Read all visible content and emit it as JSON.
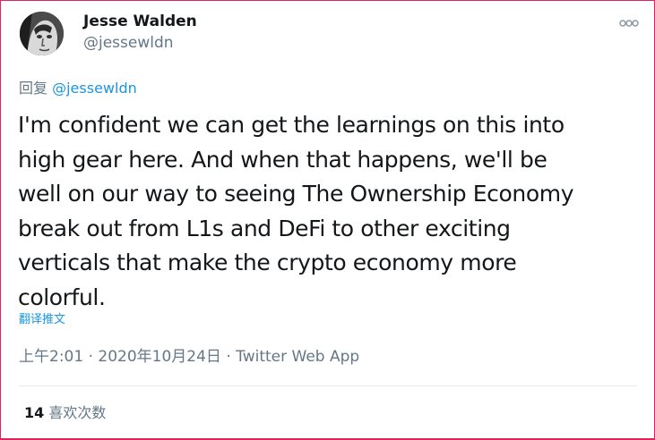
{
  "author": {
    "name": "Jesse Walden",
    "handle": "@jessewldn"
  },
  "reply": {
    "prefix": "回复",
    "mention": "@jessewldn"
  },
  "tweet": {
    "lines": [
      "I'm confident we can get the learnings on this into",
      "high gear here. And when that happens, we'll be",
      "well on our way to seeing The Ownership Economy",
      "break out from L1s and DeFi to other exciting",
      "verticals that make the crypto economy more",
      "colorful."
    ]
  },
  "translate_label": "翻译推文",
  "meta": {
    "time": "上午2:01",
    "separator": " · ",
    "date": "2020年10月24日",
    "source": "Twitter Web App"
  },
  "likes": {
    "count": "14",
    "label": "喜欢次数"
  },
  "icons": {
    "more": "more-icon",
    "avatar": "avatar"
  },
  "colors": {
    "link": "#1b95e0",
    "secondary": "#657786",
    "text": "#14171a",
    "border": "#e0245e"
  }
}
